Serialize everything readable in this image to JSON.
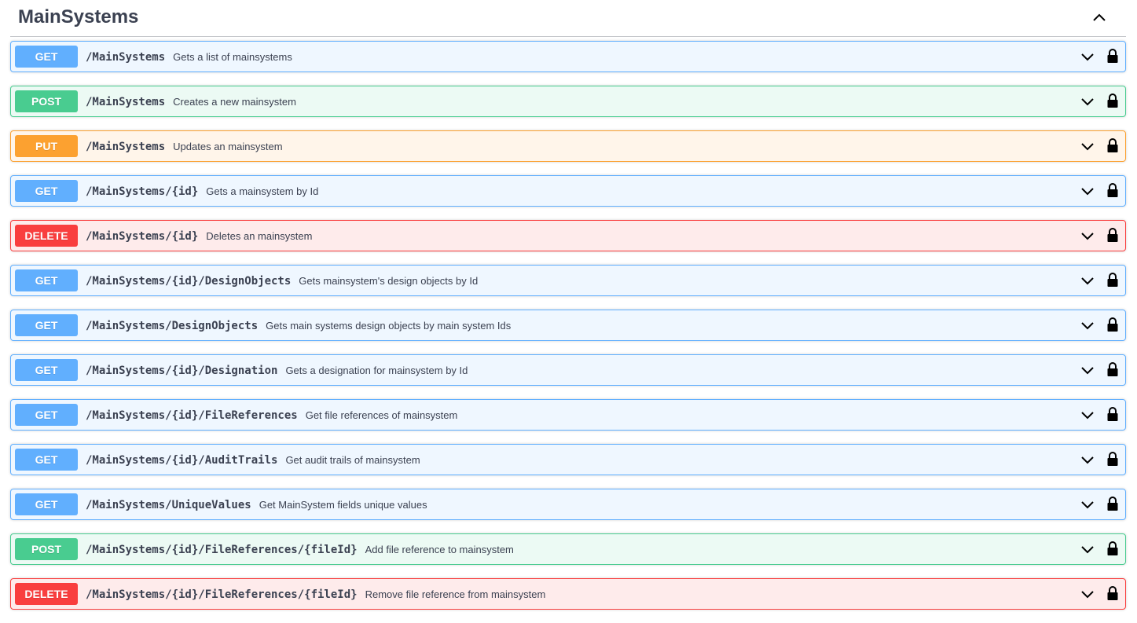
{
  "section": {
    "title": "MainSystems"
  },
  "operations": [
    {
      "method": "GET",
      "path": "/MainSystems",
      "summary": "Gets a list of mainsystems"
    },
    {
      "method": "POST",
      "path": "/MainSystems",
      "summary": "Creates a new mainsystem"
    },
    {
      "method": "PUT",
      "path": "/MainSystems",
      "summary": "Updates an mainsystem"
    },
    {
      "method": "GET",
      "path": "/MainSystems/{id}",
      "summary": "Gets a mainsystem by Id"
    },
    {
      "method": "DELETE",
      "path": "/MainSystems/{id}",
      "summary": "Deletes an mainsystem"
    },
    {
      "method": "GET",
      "path": "/MainSystems/{id}/DesignObjects",
      "summary": "Gets mainsystem's design objects by Id"
    },
    {
      "method": "GET",
      "path": "/MainSystems/DesignObjects",
      "summary": "Gets main systems design objects by main system Ids"
    },
    {
      "method": "GET",
      "path": "/MainSystems/{id}/Designation",
      "summary": "Gets a designation for mainsystem by Id"
    },
    {
      "method": "GET",
      "path": "/MainSystems/{id}/FileReferences",
      "summary": "Get file references of mainsystem"
    },
    {
      "method": "GET",
      "path": "/MainSystems/{id}/AuditTrails",
      "summary": "Get audit trails of mainsystem"
    },
    {
      "method": "GET",
      "path": "/MainSystems/UniqueValues",
      "summary": "Get MainSystem fields unique values"
    },
    {
      "method": "POST",
      "path": "/MainSystems/{id}/FileReferences/{fileId}",
      "summary": "Add file reference to mainsystem"
    },
    {
      "method": "DELETE",
      "path": "/MainSystems/{id}/FileReferences/{fileId}",
      "summary": "Remove file reference from mainsystem"
    }
  ],
  "icons": {
    "collapse": "chevron-up-icon",
    "expand": "chevron-down-icon",
    "lock": "lock-icon"
  },
  "colors": {
    "GET": "#61affe",
    "POST": "#49cc90",
    "PUT": "#fca130",
    "DELETE": "#f93e3e"
  }
}
